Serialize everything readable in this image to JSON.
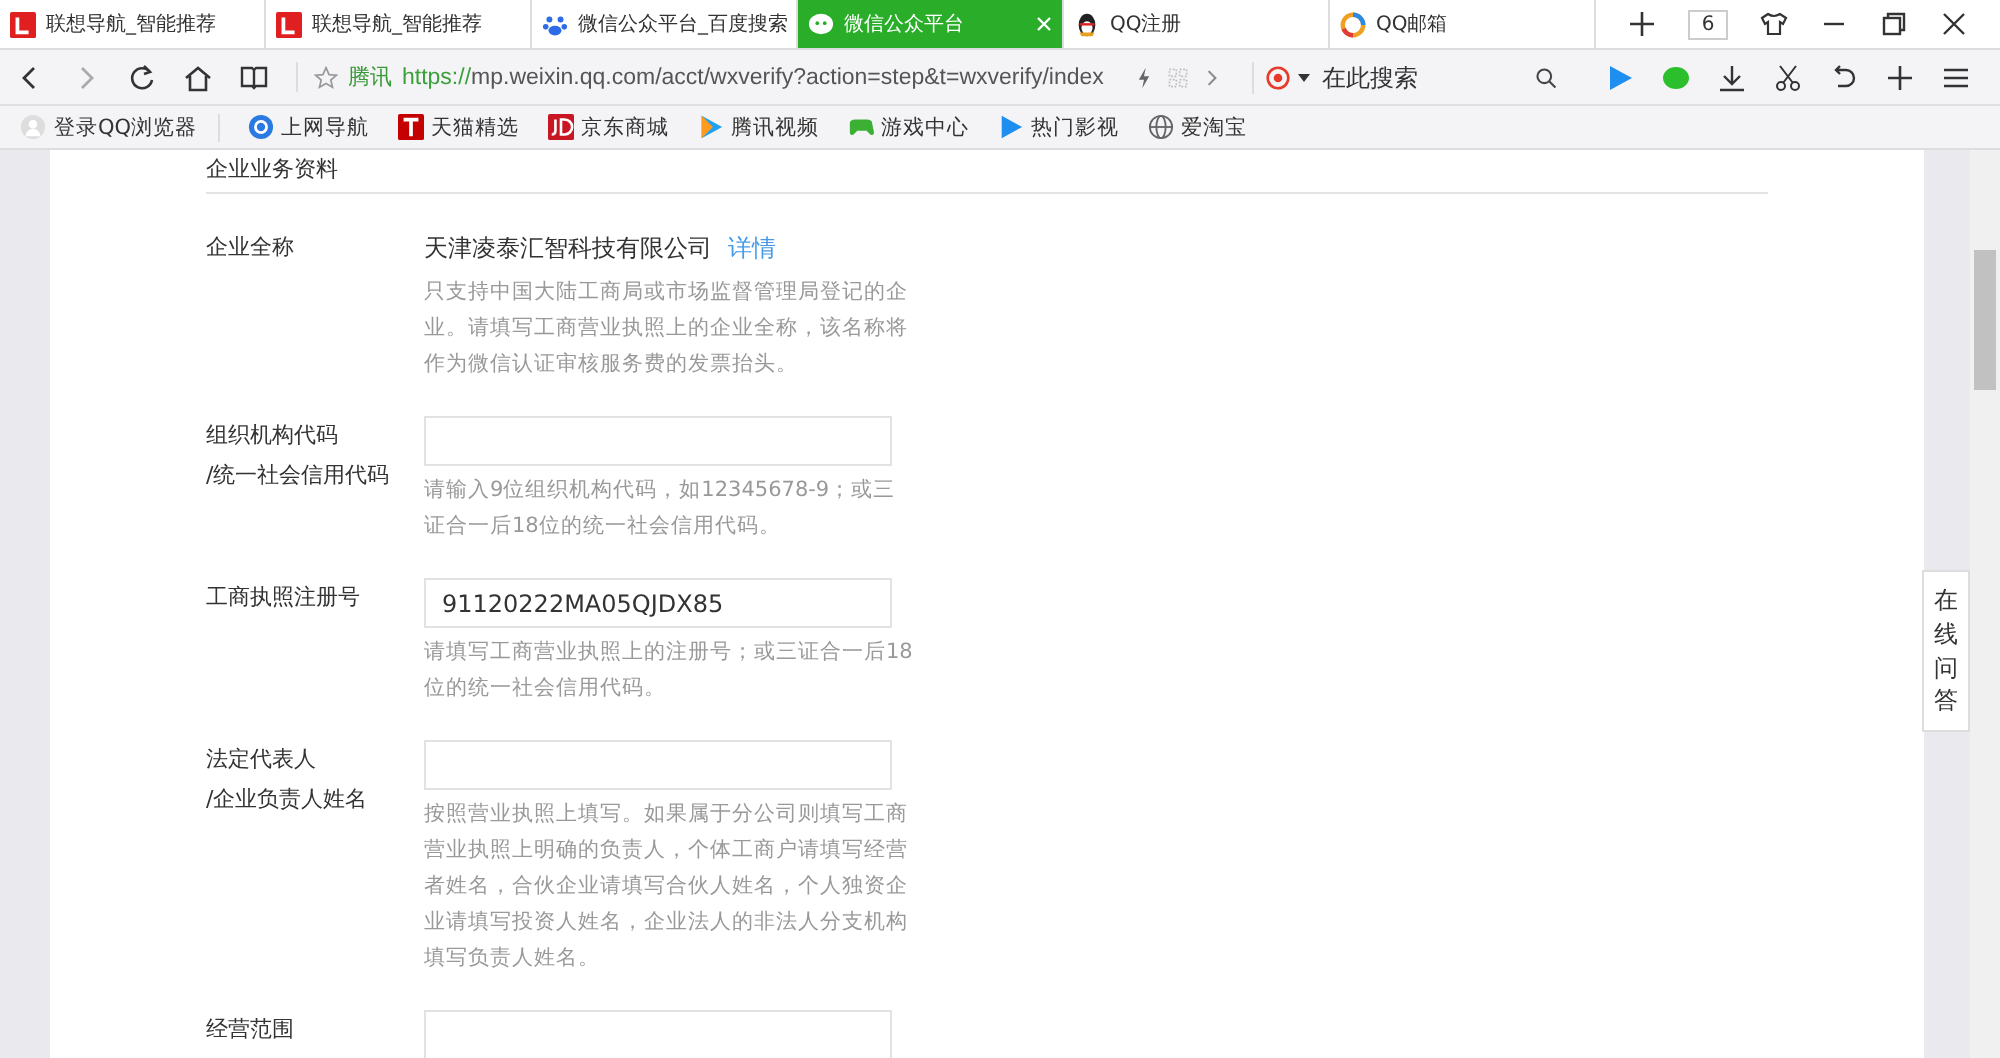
{
  "tabs": [
    {
      "title": "联想导航_智能推荐",
      "selected": false
    },
    {
      "title": "联想导航_智能推荐",
      "selected": false
    },
    {
      "title": "微信公众平台_百度搜索",
      "selected": false
    },
    {
      "title": "微信公众平台",
      "selected": true
    },
    {
      "title": "QQ注册",
      "selected": false
    },
    {
      "title": "QQ邮箱",
      "selected": false
    }
  ],
  "tab_count": "6",
  "address_bar": {
    "site_label": "腾讯",
    "scheme": "https://",
    "url": "mp.weixin.qq.com/acct/wxverify?action=step&t=wxverify/index"
  },
  "search": {
    "placeholder": "在此搜索"
  },
  "bookmarks": [
    {
      "label": "登录QQ浏览器"
    },
    {
      "label": "上网导航"
    },
    {
      "label": "天猫精选"
    },
    {
      "label": "京东商城"
    },
    {
      "label": "腾讯视频"
    },
    {
      "label": "游戏中心"
    },
    {
      "label": "热门影视"
    },
    {
      "label": "爱淘宝"
    }
  ],
  "section_title": "企业业务资料",
  "fields": [
    {
      "kind": "text",
      "label": "企业全称",
      "value": "天津凌泰汇智科技有限公司",
      "link": "详情",
      "hint": "只支持中国大陆工商局或市场监督管理局登记的企业。请填写工商营业执照上的企业全称，该名称将作为微信认证审核服务费的发票抬头。"
    },
    {
      "kind": "input",
      "label": "组织机构代码\n/统一社会信用代码",
      "hint": "请输入9位组织机构代码，如12345678-9；或三证合一后18位的统一社会信用代码。"
    },
    {
      "kind": "input",
      "label": "工商执照注册号",
      "value": "91120222MA05QJDX85",
      "hint": "请填写工商营业执照上的注册号；或三证合一后18位的统一社会信用代码。"
    },
    {
      "kind": "input",
      "label": "法定代表人\n/企业负责人姓名",
      "hint": "按照营业执照上填写。如果属于分公司则填写工商营业执照上明确的负责人，个体工商户请填写经营者姓名，合伙企业请填写合伙人姓名，个人独资企业请填写投资人姓名，企业法人的非法人分支机构填写负责人姓名。"
    },
    {
      "kind": "input",
      "label": "经营范围"
    }
  ],
  "side_tab": "在线问答"
}
